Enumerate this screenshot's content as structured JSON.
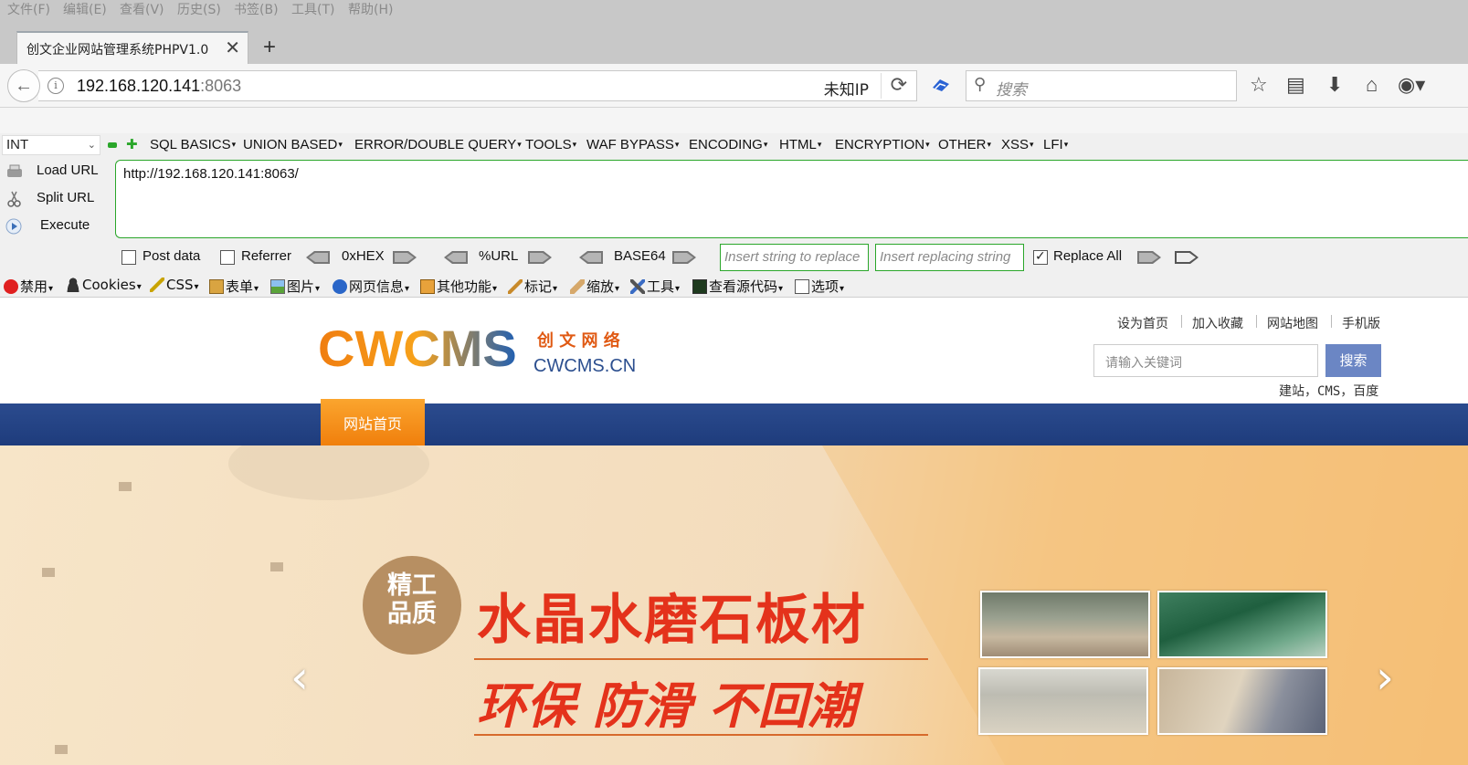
{
  "menu": [
    "文件(F)",
    "编辑(E)",
    "查看(V)",
    "历史(S)",
    "书签(B)",
    "工具(T)",
    "帮助(H)"
  ],
  "tab": {
    "title": "创文企业网站管理系统PHPV1.0",
    "close": "✕",
    "new_tab": "+"
  },
  "address": {
    "host": "192.168.120.141",
    "port": ":8063",
    "ip_label": "未知IP"
  },
  "search": {
    "placeholder": "搜索"
  },
  "hackbar": {
    "select_value": "INT",
    "menu": [
      "SQL BASICS",
      "UNION BASED",
      "ERROR/DOUBLE QUERY",
      "TOOLS",
      "WAF BYPASS",
      "ENCODING",
      "HTML",
      "ENCRYPTION",
      "OTHER",
      "XSS",
      "LFI"
    ],
    "actions": {
      "load": "Load URL",
      "split": "Split URL",
      "execute": "Execute"
    },
    "url_value": "http://192.168.120.141:8063/",
    "post_data": "Post data",
    "referrer": "Referrer",
    "hex": "0xHEX",
    "url_enc": "%URL",
    "base64": "BASE64",
    "insert_placeholder": "Insert string to replace",
    "replacing_placeholder": "Insert replacing string",
    "replace_all": "Replace All",
    "replace_all_checked": true
  },
  "ext_toolbar": [
    "禁用",
    "Cookies",
    "CSS",
    "表单",
    "图片",
    "网页信息",
    "其他功能",
    "标记",
    "缩放",
    "工具",
    "查看源代码",
    "选项"
  ],
  "site": {
    "logo_main": "CWCMS",
    "logo_cn": "创 文 网 络",
    "logo_domain": "CWCMS.CN",
    "top_links": [
      "设为首页",
      "加入收藏",
      "网站地图",
      "手机版"
    ],
    "search_placeholder": "请输入关键词",
    "search_button": "搜索",
    "hot_keywords": "建站，CMS，百度",
    "nav_home": "网站首页",
    "banner": {
      "badge_line1": "精工",
      "badge_line2": "品质",
      "slogan1": "水晶水磨石板材",
      "slogan2": "环保 防滑 不回潮",
      "prev": "‹",
      "next": "›"
    }
  }
}
